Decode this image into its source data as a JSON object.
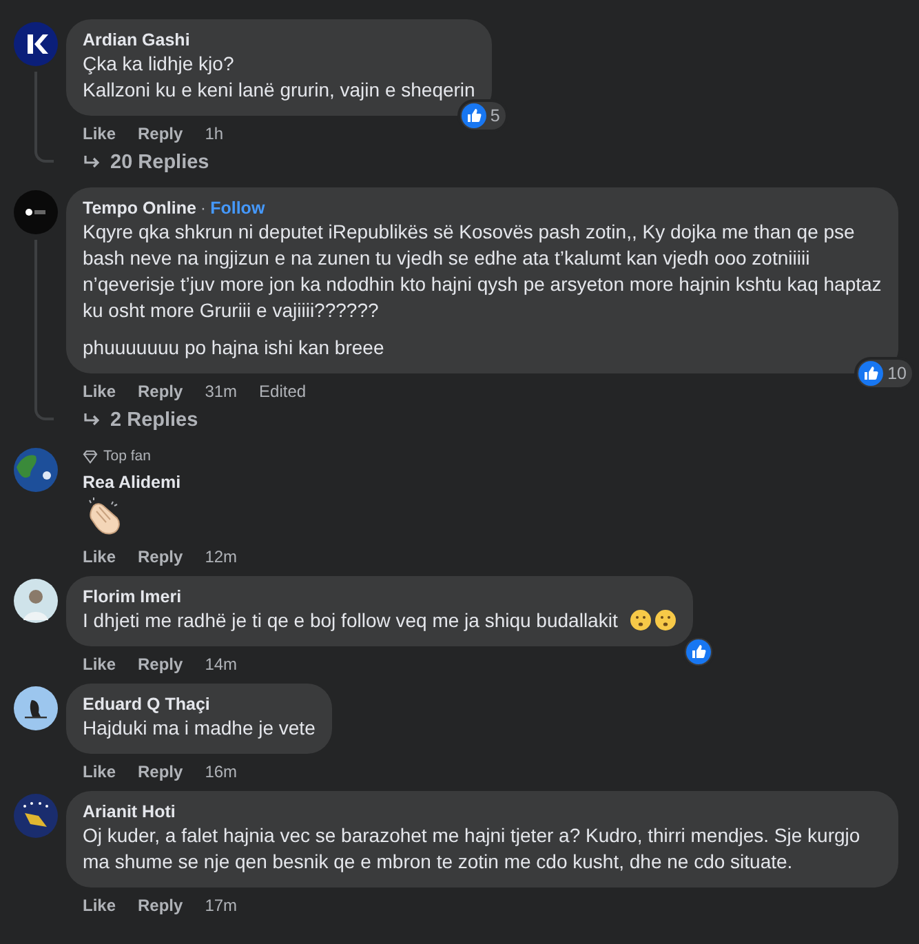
{
  "comments": [
    {
      "avatar": {
        "kind": "picture"
      },
      "name": "Ardian Gashi",
      "body": [
        "Çka ka lidhje kjo?\nKallzoni ku e keni lanë grurin, vajin e sheqerin"
      ],
      "reaction": {
        "kind": "like",
        "count": "5"
      },
      "actions": [
        "Like",
        "Reply",
        "1h"
      ],
      "replies": "20 Replies"
    },
    {
      "avatar": {
        "kind": "picture"
      },
      "name": "Tempo Online",
      "separator": "·",
      "follow": "Follow",
      "body": [
        "Kqyre qka shkrun ni deputet iRepublikës së Kosovës pash zotin,, Ky dojka me than qe pse bash neve na ingjizun e na zunen tu vjedh se edhe ata t’kalumt kan vjedh ooo zotniiiii n’qeverisje t’juv more jon ka ndodhin kto hajni qysh pe arsyeton more hajnin kshtu kaq haptaz ku osht more Gruriii e vajiiii??????",
        "phuuuuuuu po hajna ishi kan breee"
      ],
      "reaction": {
        "kind": "like",
        "count": "10"
      },
      "actions": [
        "Like",
        "Reply",
        "31m",
        "Edited"
      ],
      "replies": "2 Replies"
    },
    {
      "avatar": {
        "kind": "picture"
      },
      "badge": "Top fan",
      "name": "Rea Alidemi",
      "kind": "emoji-only",
      "actions": [
        "Like",
        "Reply",
        "12m"
      ]
    },
    {
      "avatar": {
        "kind": "picture"
      },
      "name": "Florim Imeri",
      "body": [
        "I dhjeti me radhë je ti qe e boj follow veq me ja shiqu budallakit"
      ],
      "trailing_emoji": true,
      "reaction": {
        "kind": "like"
      },
      "actions": [
        "Like",
        "Reply",
        "14m"
      ]
    },
    {
      "avatar": {
        "kind": "picture"
      },
      "name": "Eduard Q Thaçi",
      "body": [
        "Hajduki ma i madhe je vete"
      ],
      "actions": [
        "Like",
        "Reply",
        "16m"
      ]
    },
    {
      "avatar": {
        "kind": "picture"
      },
      "name": "Arianit Hoti",
      "body": [
        "Oj kuder, a falet hajnia vec se barazohet me hajni tjeter a? Kudro, thirri mendjes. Sje kurgjo ma shume se nje qen besnik qe e mbron te zotin me cdo kusht, dhe ne cdo situate."
      ],
      "actions": [
        "Like",
        "Reply",
        "17m"
      ]
    }
  ]
}
